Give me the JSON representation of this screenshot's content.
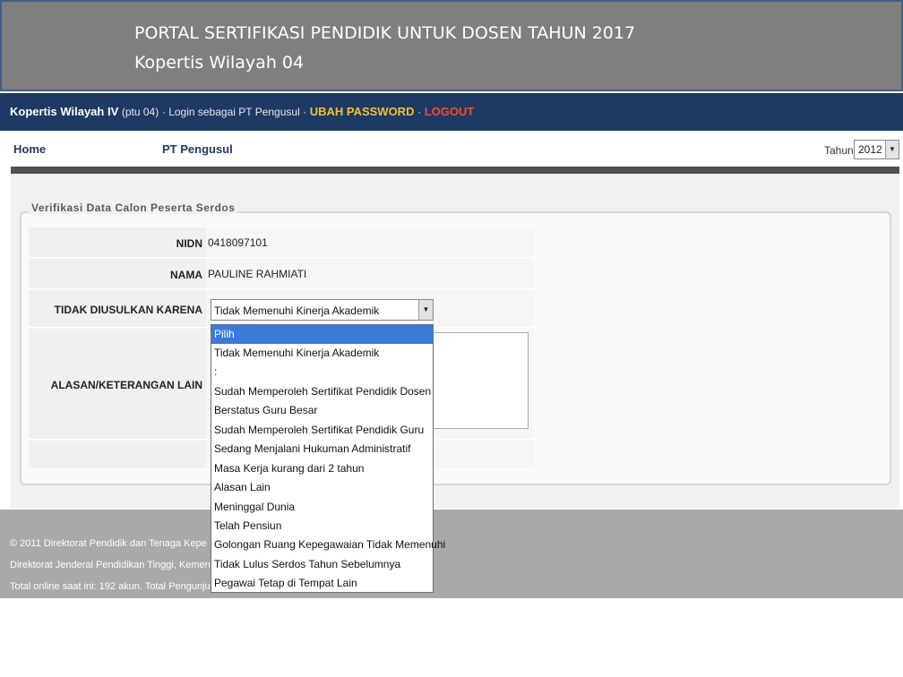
{
  "header": {
    "title_line1": "PORTAL  SERTIFIKASI PENDIDIK UNTUK DOSEN TAHUN 2017",
    "title_line2": "Kopertis Wilayah 04"
  },
  "navbar": {
    "site_name": "Kopertis Wilayah IV",
    "site_sub": "(ptu 04)",
    "login_text": "· Login sebagai PT Pengusul ·",
    "change_password": "UBAH PASSWORD",
    "separator": "·",
    "logout": "LOGOUT"
  },
  "menu": {
    "home": "Home",
    "pt_pengusul": "PT Pengusul",
    "year_label": "Tahun",
    "year_value": "2012"
  },
  "form": {
    "legend": "Verifikasi Data Calon Peserta Serdos",
    "nidn_label": "NIDN",
    "nidn_value": "0418097101",
    "nama_label": "NAMA",
    "nama_value": "PAULINE RAHMIATI",
    "reason_label": "TIDAK DIUSULKAN KARENA",
    "reason_value": "Tidak Memenuhi Kinerja Akademik",
    "other_label": "ALASAN/KETERANGAN LAIN"
  },
  "dropdown": {
    "options": [
      "Pilih",
      "Tidak Memenuhi Kinerja Akademik",
      ":",
      "Sudah Memperoleh Sertifikat Pendidik Dosen",
      "Berstatus Guru Besar",
      "Sudah Memperoleh Sertifikat Pendidik Guru",
      "Sedang Menjalani Hukuman Administratif",
      "Masa Kerja kurang dari 2 tahun",
      "Alasan Lain",
      "Meninggal Dunia",
      "Telah Pensiun",
      "Golongan Ruang Kepegawaian Tidak Memenuhi",
      "Tidak Lulus Serdos Tahun Sebelumnya",
      "Pegawai Tetap di Tempat Lain"
    ],
    "highlighted": "Pilih"
  },
  "footer": {
    "line1": "© 2011 Direktorat Pendidik dan Tenaga Kepe",
    "line2": "Direktorat Jenderal Pendidikan Tinggi, Kemen",
    "line3": "Total online saat ini: 192 akun. Total Pengunju"
  },
  "colors": {
    "title_bg": "#7f7f7f",
    "navbar_bg": "#1c3a63",
    "accent_yellow": "#f6c22a",
    "accent_red": "#ff4a2a",
    "highlight_blue": "#3a7ad9"
  }
}
